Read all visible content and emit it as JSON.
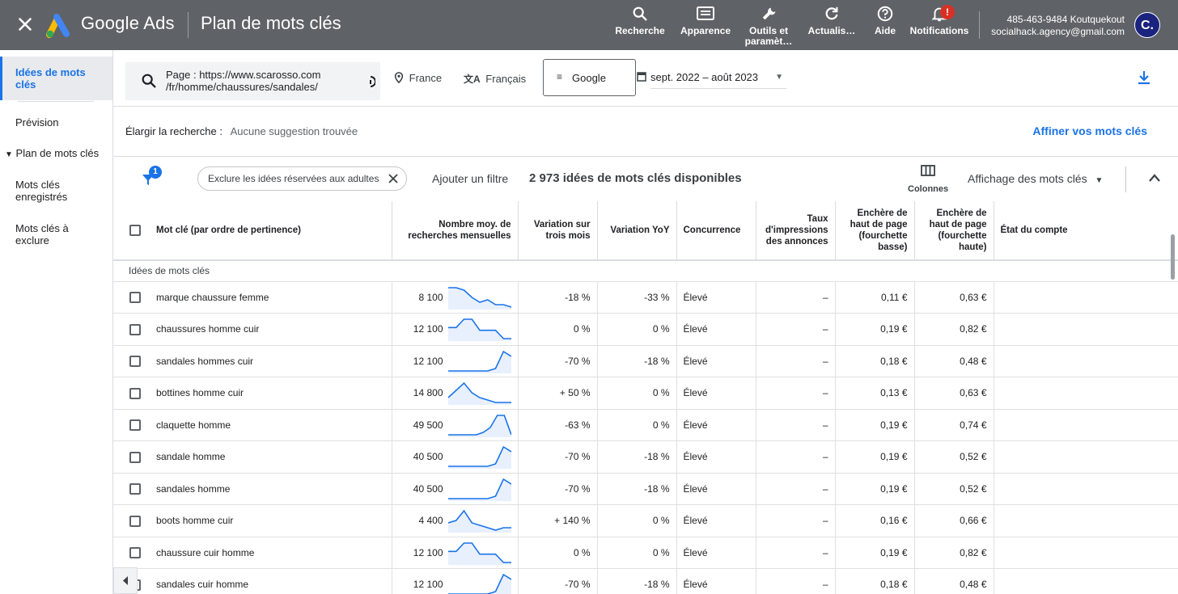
{
  "topbar": {
    "brand": "Google Ads",
    "page_title": "Plan de mots clés",
    "tools": [
      {
        "label": "Recherche",
        "icon": "search-icon"
      },
      {
        "label": "Apparence",
        "icon": "appearance-icon"
      },
      {
        "label": "Outils et paramèt…",
        "icon": "wrench-icon"
      },
      {
        "label": "Actualis…",
        "icon": "refresh-icon"
      },
      {
        "label": "Aide",
        "icon": "help-icon"
      },
      {
        "label": "Notifications",
        "icon": "bell-icon",
        "badge": "!"
      }
    ],
    "account_id": "485-463-9484 Koutquekout",
    "account_email": "socialhack.agency@gmail.com",
    "avatar_letter": "C."
  },
  "sidebar": {
    "items": [
      {
        "label": "Idées de mots clés",
        "active": true
      },
      {
        "label": "Prévision"
      },
      {
        "label": "Plan de mots clés"
      },
      {
        "label": "Mots clés enregistrés"
      },
      {
        "label": "Mots clés à exclure"
      }
    ]
  },
  "search": {
    "line1": "Page : https://www.scarosso.com",
    "line2": "/fr/homme/chaussures/sandales/",
    "location": "France",
    "language": "Français",
    "network": "Google",
    "dates": "sept. 2022 – août 2023"
  },
  "broaden": {
    "label": "Élargir la recherche :",
    "value": "Aucune suggestion trouvée",
    "refine": "Affiner vos mots clés"
  },
  "filters": {
    "badge": "1",
    "chip": "Exclure les idées réservées aux adultes",
    "add_filter": "Ajouter un filtre",
    "count": "2 973 idées de mots clés disponibles",
    "columns": "Colonnes",
    "view": "Affichage des mots clés"
  },
  "table": {
    "headers": {
      "keyword": "Mot clé (par ordre de pertinence)",
      "volume": "Nombre moy. de recherches mensuelles",
      "three_month": "Variation sur trois mois",
      "yoy": "Variation YoY",
      "competition": "Concurrence",
      "impression_share": "Taux d'impressions des annonces",
      "bid_low": "Enchère de haut de page (fourchette basse)",
      "bid_high": "Enchère de haut de page (fourchette haute)",
      "account_status": "État du compte"
    },
    "group_label": "Idées de mots clés",
    "rows": [
      {
        "keyword": "marque chaussure femme",
        "volume": "8 100",
        "three_month": "-18 %",
        "yoy": "-33 %",
        "competition": "Élevé",
        "impr": "–",
        "low": "0,11 €",
        "high": "0,63 €",
        "trend": [
          9,
          9,
          8,
          5,
          3,
          4,
          2,
          2,
          1
        ]
      },
      {
        "keyword": "chaussures homme cuir",
        "volume": "12 100",
        "three_month": "0 %",
        "yoy": "0 %",
        "competition": "Élevé",
        "impr": "–",
        "low": "0,19 €",
        "high": "0,82 €",
        "trend": [
          5,
          5,
          8,
          8,
          4,
          4,
          4,
          1,
          1
        ]
      },
      {
        "keyword": "sandales hommes cuir",
        "volume": "12 100",
        "three_month": "-70 %",
        "yoy": "-18 %",
        "competition": "Élevé",
        "impr": "–",
        "low": "0,18 €",
        "high": "0,48 €",
        "trend": [
          1,
          1,
          1,
          1,
          1,
          1,
          2,
          9,
          7
        ]
      },
      {
        "keyword": "bottines homme cuir",
        "volume": "14 800",
        "three_month": "+ 50 %",
        "yoy": "0 %",
        "competition": "Élevé",
        "impr": "–",
        "low": "0,13 €",
        "high": "0,63 €",
        "trend": [
          3,
          6,
          9,
          5,
          3,
          2,
          1,
          1,
          1
        ]
      },
      {
        "keyword": "claquette homme",
        "volume": "49 500",
        "three_month": "-63 %",
        "yoy": "0 %",
        "competition": "Élevé",
        "impr": "–",
        "low": "0,19 €",
        "high": "0,74 €",
        "trend": [
          1,
          1,
          1,
          1,
          1,
          2,
          4,
          9,
          9,
          1
        ]
      },
      {
        "keyword": "sandale homme",
        "volume": "40 500",
        "three_month": "-70 %",
        "yoy": "-18 %",
        "competition": "Élevé",
        "impr": "–",
        "low": "0,19 €",
        "high": "0,52 €",
        "trend": [
          1,
          1,
          1,
          1,
          1,
          1,
          2,
          9,
          7
        ]
      },
      {
        "keyword": "sandales homme",
        "volume": "40 500",
        "three_month": "-70 %",
        "yoy": "-18 %",
        "competition": "Élevé",
        "impr": "–",
        "low": "0,19 €",
        "high": "0,52 €",
        "trend": [
          1,
          1,
          1,
          1,
          1,
          1,
          2,
          9,
          7
        ]
      },
      {
        "keyword": "boots homme cuir",
        "volume": "4 400",
        "three_month": "+ 140 %",
        "yoy": "0 %",
        "competition": "Élevé",
        "impr": "–",
        "low": "0,16 €",
        "high": "0,66 €",
        "trend": [
          4,
          5,
          9,
          4,
          3,
          2,
          1,
          2,
          2
        ]
      },
      {
        "keyword": "chaussure cuir homme",
        "volume": "12 100",
        "three_month": "0 %",
        "yoy": "0 %",
        "competition": "Élevé",
        "impr": "–",
        "low": "0,19 €",
        "high": "0,82 €",
        "trend": [
          5,
          5,
          8,
          8,
          4,
          4,
          4,
          1,
          1
        ]
      },
      {
        "keyword": "sandales cuir homme",
        "volume": "12 100",
        "three_month": "-70 %",
        "yoy": "-18 %",
        "competition": "Élevé",
        "impr": "–",
        "low": "0,18 €",
        "high": "0,48 €",
        "trend": [
          1,
          1,
          1,
          1,
          1,
          1,
          2,
          9,
          7
        ]
      }
    ]
  },
  "colors": {
    "topbar": "#5f6368",
    "accent": "#1a73e8",
    "spark": "#1a73e8",
    "spark_fill": "#e8f0fe"
  }
}
